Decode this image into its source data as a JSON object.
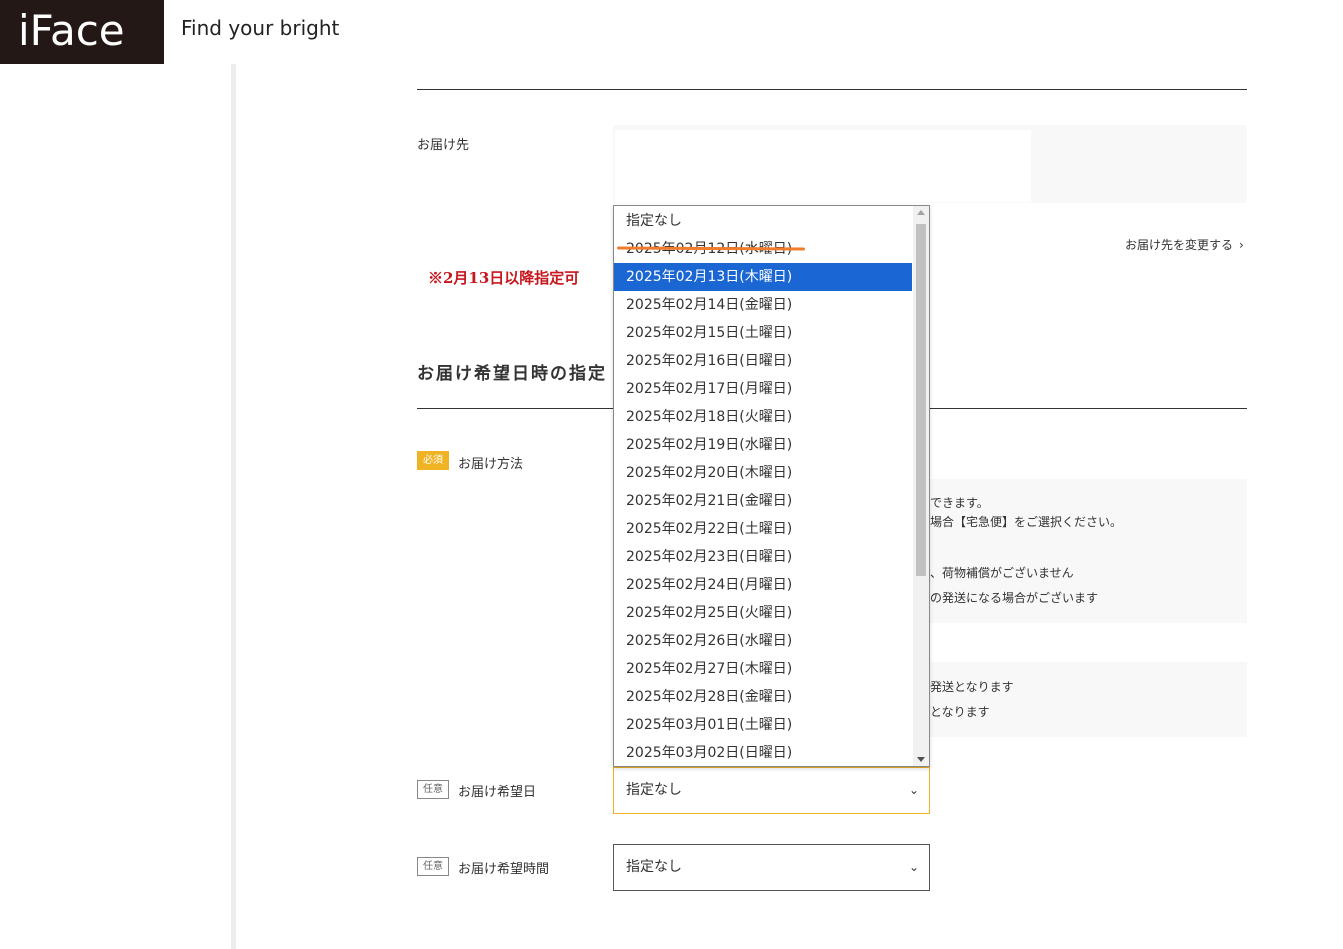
{
  "header": {
    "logo": "iFace",
    "tagline": "Find your bright"
  },
  "destination": {
    "label": "お届け先",
    "change_link": "お届け先を変更する",
    "change_chevron": "›"
  },
  "annotation": {
    "note": "※2月13日以降指定可",
    "strike_color": "#f07c2e"
  },
  "delivery_section": {
    "title": "お届け希望日時の指定",
    "method_badge": "必須",
    "method_label": "お届け方法",
    "info_lines": [
      "できます。",
      "場合【宅急便】をご選択ください。",
      "、荷物補償がございません",
      "の発送になる場合がございます",
      "発送となります",
      "となります"
    ],
    "date_badge": "任意",
    "date_label": "お届け希望日",
    "date_value": "指定なし",
    "time_badge": "任意",
    "time_label": "お届け希望時間",
    "time_value": "指定なし"
  },
  "date_dropdown": {
    "selected_index": 2,
    "options": [
      "指定なし",
      "2025年02月12日(水曜日)",
      "2025年02月13日(木曜日)",
      "2025年02月14日(金曜日)",
      "2025年02月15日(土曜日)",
      "2025年02月16日(日曜日)",
      "2025年02月17日(月曜日)",
      "2025年02月18日(火曜日)",
      "2025年02月19日(水曜日)",
      "2025年02月20日(木曜日)",
      "2025年02月21日(金曜日)",
      "2025年02月22日(土曜日)",
      "2025年02月23日(日曜日)",
      "2025年02月24日(月曜日)",
      "2025年02月25日(火曜日)",
      "2025年02月26日(水曜日)",
      "2025年02月27日(木曜日)",
      "2025年02月28日(金曜日)",
      "2025年03月01日(土曜日)",
      "2025年03月02日(日曜日)"
    ]
  },
  "icons": {
    "caret": "chevron-down-icon",
    "caret_glyph": "⌄"
  },
  "colors": {
    "accent": "#f0b323",
    "selected": "#1a66d2",
    "note_red": "#c8161d",
    "logo_bg": "#231815"
  }
}
